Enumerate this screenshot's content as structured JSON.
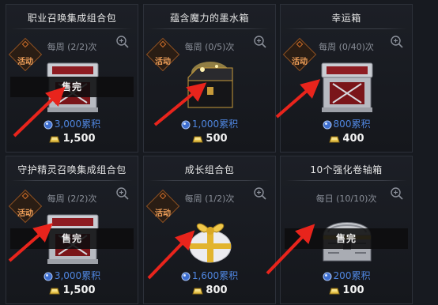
{
  "labels": {
    "event_badge": "活动",
    "sold_out": "售完"
  },
  "colors": {
    "background": "#171a20",
    "points_text": "#4f86e0",
    "badge_text": "#f0a05a",
    "annotation_arrow": "#e8241c"
  },
  "items": [
    {
      "title": "职业召唤集成组合包",
      "limit": "每周 (2/2)次",
      "event": true,
      "sold_out": true,
      "points": "3,000累积",
      "gold": "1,500",
      "box_icon": "silver-red-chest-icon"
    },
    {
      "title": "蕴含魔力的墨水箱",
      "limit": "每周 (0/5)次",
      "event": true,
      "sold_out": false,
      "points": "1,000累积",
      "gold": "500",
      "box_icon": "black-glowing-chest-icon"
    },
    {
      "title": "幸运箱",
      "limit": "每周 (0/40)次",
      "event": true,
      "sold_out": false,
      "points": "800累积",
      "gold": "400",
      "box_icon": "silver-red-chest-icon"
    },
    {
      "title": "守护精灵召唤集成组合包",
      "limit": "每周 (2/2)次",
      "event": true,
      "sold_out": true,
      "points": "3,000累积",
      "gold": "1,500",
      "box_icon": "silver-red-chest-icon"
    },
    {
      "title": "成长组合包",
      "limit": "每周 (1/2)次",
      "event": true,
      "sold_out": false,
      "points": "1,600累积",
      "gold": "800",
      "box_icon": "gold-ribbon-gift-icon"
    },
    {
      "title": "10个强化卷轴箱",
      "limit": "每日 (10/10)次",
      "event": false,
      "sold_out": true,
      "points": "200累积",
      "gold": "100",
      "box_icon": "silver-treasure-chest-icon"
    }
  ]
}
